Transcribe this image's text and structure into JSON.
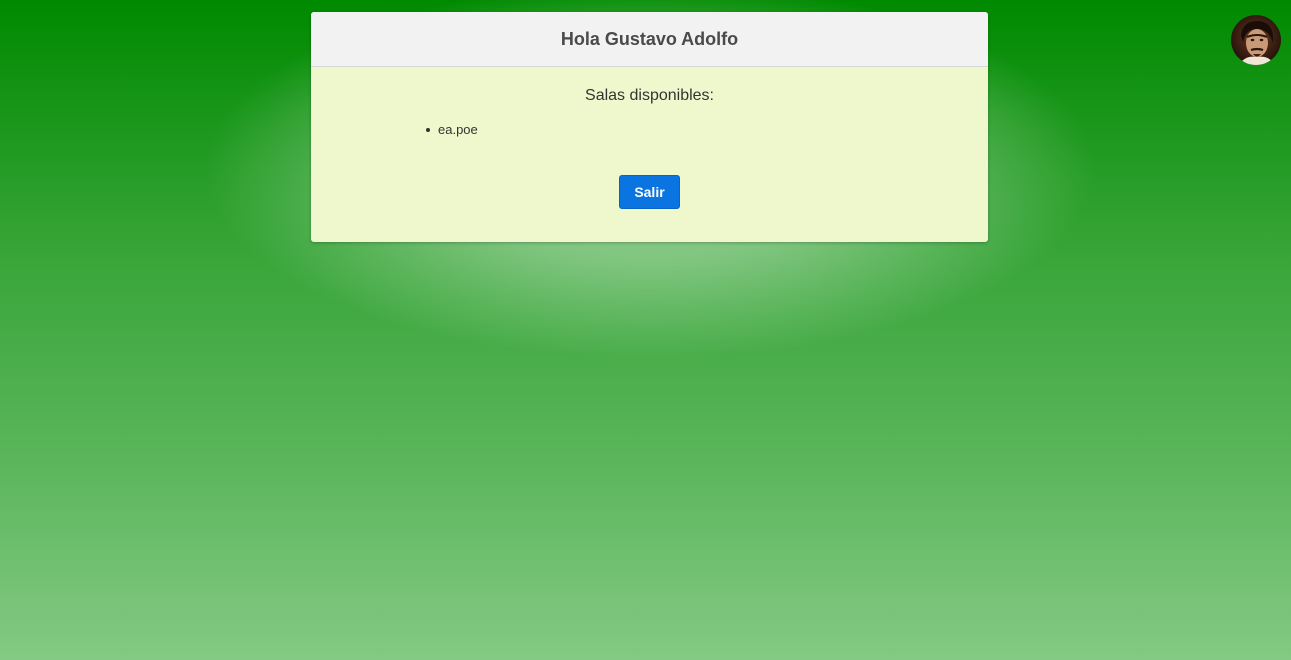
{
  "header": {
    "greeting": "Hola Gustavo Adolfo"
  },
  "rooms": {
    "heading": "Salas disponibles:",
    "items": [
      "ea.poe"
    ]
  },
  "actions": {
    "exit_label": "Salir"
  },
  "colors": {
    "background_top": "#008a00",
    "background_bottom": "#84c984",
    "card_body": "#eff8cc",
    "card_header": "#f2f2f2",
    "button": "#0a74e0"
  }
}
